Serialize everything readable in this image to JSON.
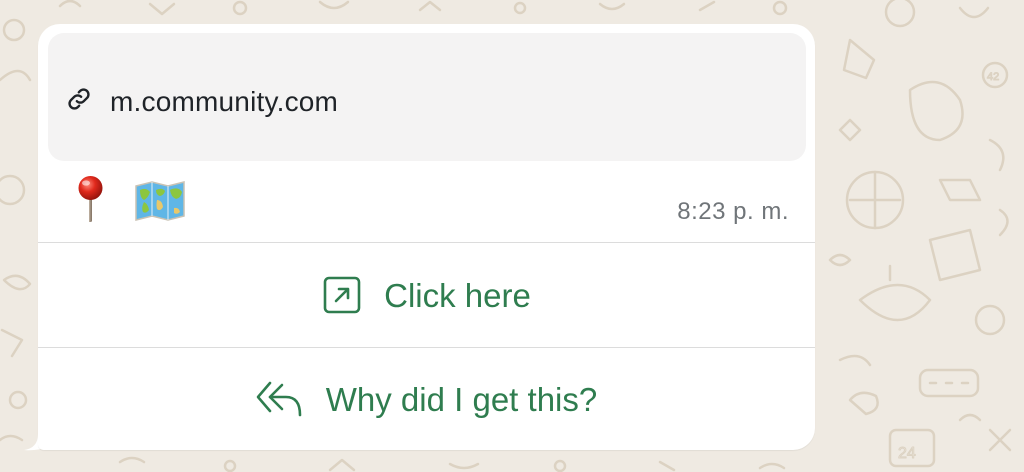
{
  "message": {
    "link_preview": {
      "icon": "link-icon",
      "domain": "m.community.com"
    },
    "emojis": [
      {
        "name": "round-pushpin-emoji",
        "char": "📍"
      },
      {
        "name": "world-map-emoji",
        "char": "🗺️"
      }
    ],
    "timestamp": "8:23 p. m."
  },
  "actions": [
    {
      "name": "click-here-button",
      "icon": "external-link-icon",
      "label": "Click here"
    },
    {
      "name": "why-did-i-get-this-button",
      "icon": "reply-all-icon",
      "label": "Why did I get this?"
    }
  ],
  "colors": {
    "wallpaper": "#efeae2",
    "bubble": "#ffffff",
    "preview_bg": "#f4f3f3",
    "action_green": "#2f7d4f",
    "timestamp_gray": "#707579"
  }
}
